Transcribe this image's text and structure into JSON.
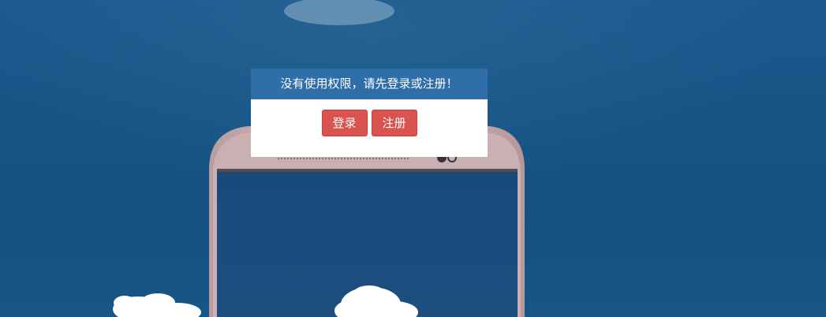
{
  "dialog": {
    "message": "没有使用权限，请先登录或注册！",
    "login_label": "登录",
    "register_label": "注册"
  },
  "colors": {
    "dialog_header": "#2f6ea8",
    "button_bg": "#d9534f",
    "sky": "#175486"
  }
}
